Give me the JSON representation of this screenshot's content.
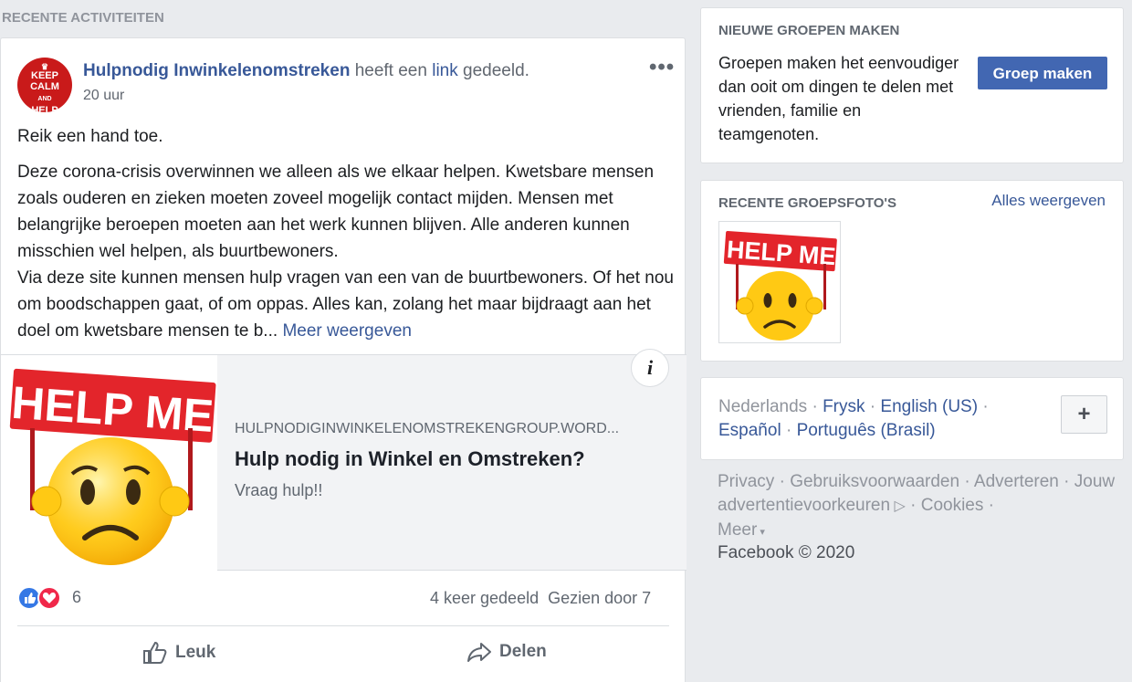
{
  "section": {
    "title": "RECENTE ACTIVITEITEN"
  },
  "post": {
    "avatar_text": "KEEP CALM AND HELP",
    "author": "Hulpnodig Inwinkelenomstreken",
    "shared_text_1": "heeft een",
    "shared_link": "link",
    "shared_text_2": "gedeeld.",
    "time": "20 uur",
    "more_icon": "more-dots-icon",
    "paragraph_1": "Reik een hand toe.",
    "paragraph_2": "Deze corona-crisis overwinnen we alleen als we elkaar helpen. Kwetsbare mensen zoals ouderen en zieken moeten zoveel mogelijk contact mijden. Mensen met belangrijke beroepen moeten aan het werk kunnen blijven. Alle anderen kunnen misschien wel helpen, als buurtbewoners.",
    "paragraph_3": "Via deze site kunnen mensen hulp vragen van een van de buurtbewoners. Of het nou om boodschappen gaat, of om oppas. Alles kan, zolang het maar bijdraagt aan het doel om kwetsbare mensen te b...",
    "show_more": "Meer weergeven",
    "link_card": {
      "image_text": "HELP ME",
      "domain": "HULPNODIGINWINKELENOMSTREKENGROUP.WORD...",
      "title": "Hulp nodig in Winkel en Omstreken?",
      "description": "Vraag hulp!!",
      "info_icon": "i"
    },
    "reaction_count": "6",
    "shares": "4 keer gedeeld",
    "seen_by": "Gezien door 7",
    "like_label": "Leuk",
    "share_label": "Delen"
  },
  "sidebar": {
    "create_group": {
      "title": "NIEUWE GROEPEN MAKEN",
      "description": "Groepen maken het eenvoudiger dan ooit om dingen te delen met vrienden, familie en teamgenoten.",
      "button": "Groep maken"
    },
    "recent_photos": {
      "title": "RECENTE GROEPSFOTO'S",
      "show_all": "Alles weergeven",
      "photo_text": "HELP ME"
    },
    "languages": {
      "current": "Nederlands",
      "options": [
        "Frysk",
        "English (US)",
        "Español",
        "Português (Brasil)"
      ],
      "add_label": "+"
    },
    "footer": {
      "links": [
        "Privacy",
        "Gebruiksvoorwaarden",
        "Adverteren",
        "Jouw advertentievoorkeuren",
        "Cookies",
        "Meer"
      ],
      "copyright": "Facebook © 2020"
    }
  },
  "colors": {
    "brand": "#4267b2",
    "link": "#385898",
    "like": "#3578e5",
    "love": "#f0284a",
    "banner": "#e3252b"
  }
}
